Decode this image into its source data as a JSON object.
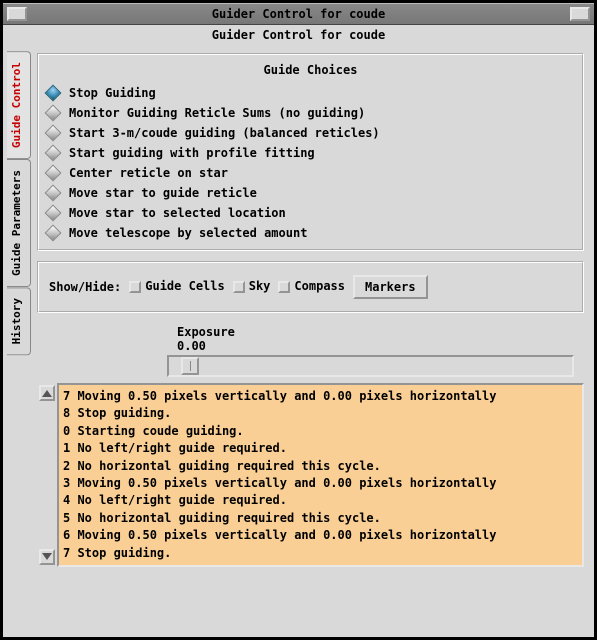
{
  "window": {
    "title": "Guider Control for coude",
    "subtitle": "Guider Control for coude"
  },
  "tabs": [
    {
      "label": "Guide Control",
      "selected": true
    },
    {
      "label": "Guide Parameters",
      "selected": false
    },
    {
      "label": "History",
      "selected": false
    }
  ],
  "choices": {
    "title": "Guide Choices",
    "items": [
      {
        "label": "Stop Guiding",
        "selected": true
      },
      {
        "label": "Monitor Guiding Reticle Sums (no guiding)",
        "selected": false
      },
      {
        "label": "Start 3-m/coude guiding (balanced reticles)",
        "selected": false
      },
      {
        "label": "Start guiding with profile fitting",
        "selected": false
      },
      {
        "label": "Center reticle on star",
        "selected": false
      },
      {
        "label": "Move star to guide reticle",
        "selected": false
      },
      {
        "label": "Move star to selected location",
        "selected": false
      },
      {
        "label": "Move telescope by selected amount",
        "selected": false
      }
    ]
  },
  "showhide": {
    "label": "Show/Hide:",
    "checks": [
      {
        "label": "Guide\nCells"
      },
      {
        "label": "Sky"
      },
      {
        "label": "Compass"
      }
    ],
    "button": "Markers"
  },
  "exposure": {
    "label": "Exposure",
    "value": "0.00"
  },
  "history": {
    "lines": [
      "7 Moving 0.50 pixels vertically and 0.00 pixels horizontally",
      "8 Stop guiding.",
      "0 Starting coude guiding.",
      "1 No left/right guide required.",
      "2 No horizontal guiding required this cycle.",
      "3 Moving 0.50 pixels vertically and 0.00 pixels horizontally",
      "4 No left/right guide required.",
      "5 No horizontal guiding required this cycle.",
      "6 Moving 0.50 pixels vertically and 0.00 pixels horizontally",
      "7 Stop guiding."
    ]
  }
}
